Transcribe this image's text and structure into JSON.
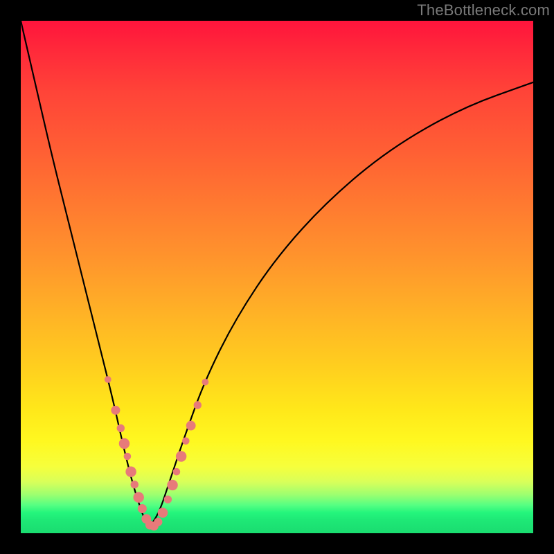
{
  "watermark": "TheBottleneck.com",
  "colors": {
    "frame": "#000000",
    "curve": "#000000",
    "bead": "#e77a7a",
    "gradient_top": "#ff143c",
    "gradient_bottom": "#1adc70"
  },
  "chart_data": {
    "type": "line",
    "title": "",
    "xlabel": "",
    "ylabel": "",
    "xlim": [
      0,
      100
    ],
    "ylim": [
      0,
      100
    ],
    "note": "No axes or tick labels are visible; values are normalized 0–100. y is a bottleneck-style absolute deviation curve with its minimum (≈0) near x≈25, rising steeply toward x→0 and more gradually toward x→100.",
    "series": [
      {
        "name": "bottleneck-curve",
        "x": [
          0,
          3,
          6,
          9,
          12,
          15,
          18,
          20,
          22,
          24,
          25,
          27,
          29,
          32,
          36,
          42,
          50,
          60,
          72,
          86,
          100
        ],
        "values": [
          100,
          87,
          74,
          62,
          50,
          38,
          26,
          17,
          9,
          3,
          1,
          4,
          10,
          19,
          30,
          42,
          54,
          65,
          75,
          83,
          88
        ]
      }
    ],
    "markers": {
      "name": "beads",
      "note": "Salmon-colored dots clustered along the lower portion of the curve near the V.",
      "points": [
        {
          "x": 17.0,
          "y": 30.0,
          "r": 1.2
        },
        {
          "x": 18.5,
          "y": 24.0,
          "r": 1.6
        },
        {
          "x": 19.5,
          "y": 20.5,
          "r": 1.4
        },
        {
          "x": 20.2,
          "y": 17.5,
          "r": 1.9
        },
        {
          "x": 20.8,
          "y": 15.0,
          "r": 1.3
        },
        {
          "x": 21.5,
          "y": 12.0,
          "r": 1.9
        },
        {
          "x": 22.2,
          "y": 9.5,
          "r": 1.4
        },
        {
          "x": 23.0,
          "y": 7.0,
          "r": 1.9
        },
        {
          "x": 23.7,
          "y": 4.8,
          "r": 1.6
        },
        {
          "x": 24.5,
          "y": 2.8,
          "r": 1.7
        },
        {
          "x": 25.2,
          "y": 1.6,
          "r": 1.6
        },
        {
          "x": 26.0,
          "y": 1.4,
          "r": 1.6
        },
        {
          "x": 26.8,
          "y": 2.2,
          "r": 1.5
        },
        {
          "x": 27.7,
          "y": 4.0,
          "r": 1.8
        },
        {
          "x": 28.7,
          "y": 6.6,
          "r": 1.4
        },
        {
          "x": 29.6,
          "y": 9.4,
          "r": 1.9
        },
        {
          "x": 30.4,
          "y": 12.0,
          "r": 1.3
        },
        {
          "x": 31.3,
          "y": 15.0,
          "r": 1.9
        },
        {
          "x": 32.2,
          "y": 18.0,
          "r": 1.3
        },
        {
          "x": 33.2,
          "y": 21.0,
          "r": 1.7
        },
        {
          "x": 34.5,
          "y": 25.0,
          "r": 1.4
        },
        {
          "x": 36.0,
          "y": 29.5,
          "r": 1.2
        }
      ]
    }
  }
}
